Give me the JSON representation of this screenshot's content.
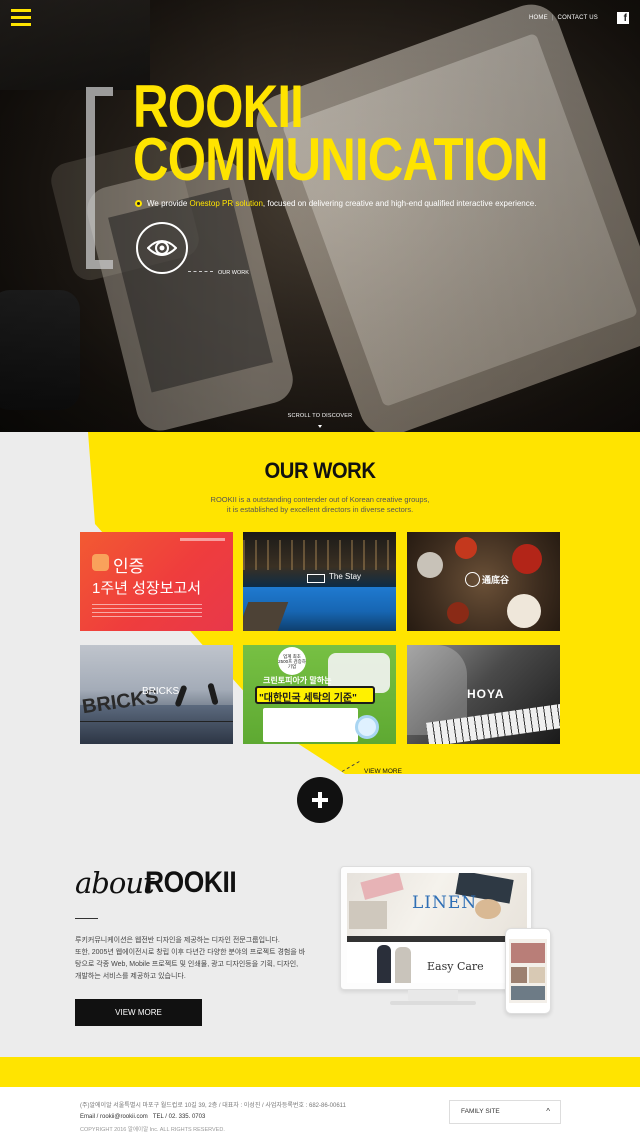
{
  "header": {
    "home": "HOME",
    "separator": "|",
    "contact": "CONTACT US",
    "facebook_icon": "f"
  },
  "hero": {
    "title_line1": "ROOKII",
    "title_line2": "COMMUNICATION",
    "desc_prefix": "We provide ",
    "desc_highlight": "Onestop PR solution",
    "desc_suffix": ", focused on delivering creative and high-end qualified interactive experience.",
    "our_work_link": "OUR WORK",
    "scroll": "SCROLL TO DISCOVER"
  },
  "work": {
    "title": "OUR WORK",
    "sub_line1": "ROOKII is a outstanding contender out of Korean creative groups,",
    "sub_line2": "it is established by excellent directors in diverse sectors.",
    "tiles": [
      {
        "line1": "인증",
        "line2": "1주년 성장보고서"
      },
      {
        "name": "The Stay"
      },
      {
        "name": "通底谷"
      },
      {
        "name": "BRICKS",
        "letters": "BRICKS"
      },
      {
        "badge": "업계 최초 2500프 검증하기업",
        "line1": "크린토피아가 말하는",
        "line2": "\"대한민국 세탁의 기준\""
      },
      {
        "name": "HOYA"
      }
    ],
    "view_more": "VIEW MORE"
  },
  "about": {
    "script": "about",
    "brand": "ROOKII",
    "text_line1": "루키커뮤니케이션은 웹전반 디자인을 제공하는 디자인 전문그룹입니다.",
    "text_line2": "또한, 2005년 웹에이전시로 창립 이후 다년간 다양한 분야의 프로젝트 경험을 바",
    "text_line3": "탕으로 각종 Web, Mobile 프로젝트 및 인쇄물, 광고 디자인등을 기획, 디자인,",
    "text_line4": "개발하는 서비스를 제공하고 있습니다.",
    "button": "VIEW MORE",
    "monitor_brand": "LINEN",
    "monitor_slogan": "Easy Care"
  },
  "footer": {
    "address": "(주)알에이알 서울특별시 마포구 월드컵로 10길 39, 2층 / 대표자 : 이성진 / 사업자등록번호 : 682-86-00611",
    "email_label": "Email / ",
    "email": "rookii@rookii.com",
    "tel_label": "TEL / ",
    "tel": "02. 335. 0703",
    "copyright": "COPYRIGHT 2016 알에이알 Inc. ALL RIGHTS RESERVED.",
    "family_site": "FAMILY SITE",
    "caret": "^"
  },
  "colors": {
    "accent": "#ffe400",
    "dark": "#111111",
    "background": "#ececec"
  }
}
